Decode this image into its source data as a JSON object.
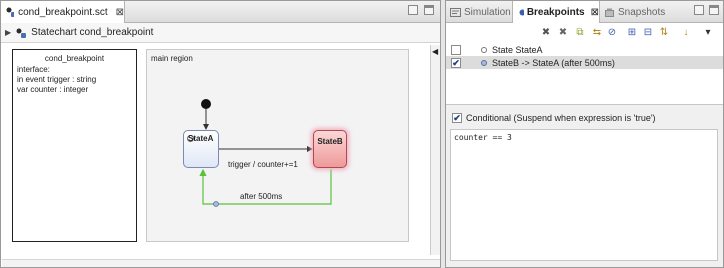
{
  "editor": {
    "tab_label": "cond_breakpoint.sct",
    "tab_close": "⊠",
    "breadcrumb": "Statechart cond_breakpoint",
    "interface": {
      "title": "cond_breakpoint",
      "lines": [
        "interface:",
        "in event trigger : string",
        "var counter : integer"
      ]
    },
    "region": {
      "title": "main region",
      "state_a": "StateA",
      "state_b": "StateB",
      "transition_trigger": "trigger / counter+=1",
      "transition_after": "after 500ms"
    }
  },
  "right": {
    "tabs": [
      {
        "label": "Simulation"
      },
      {
        "label": "Breakpoints",
        "close": "⊠"
      },
      {
        "label": "Snapshots"
      }
    ],
    "breakpoints": [
      {
        "label": "State StateA",
        "checked": false
      },
      {
        "label": "StateB -> StateA (after 500ms)",
        "checked": true
      }
    ],
    "conditional_label": "Conditional (Suspend when expression is 'true')",
    "condition_expression": "counter == 3"
  },
  "colors": {
    "state_a_fill": "#dfe7f6",
    "state_b_fill": "#ef9999",
    "active_transition": "#58c23a"
  }
}
